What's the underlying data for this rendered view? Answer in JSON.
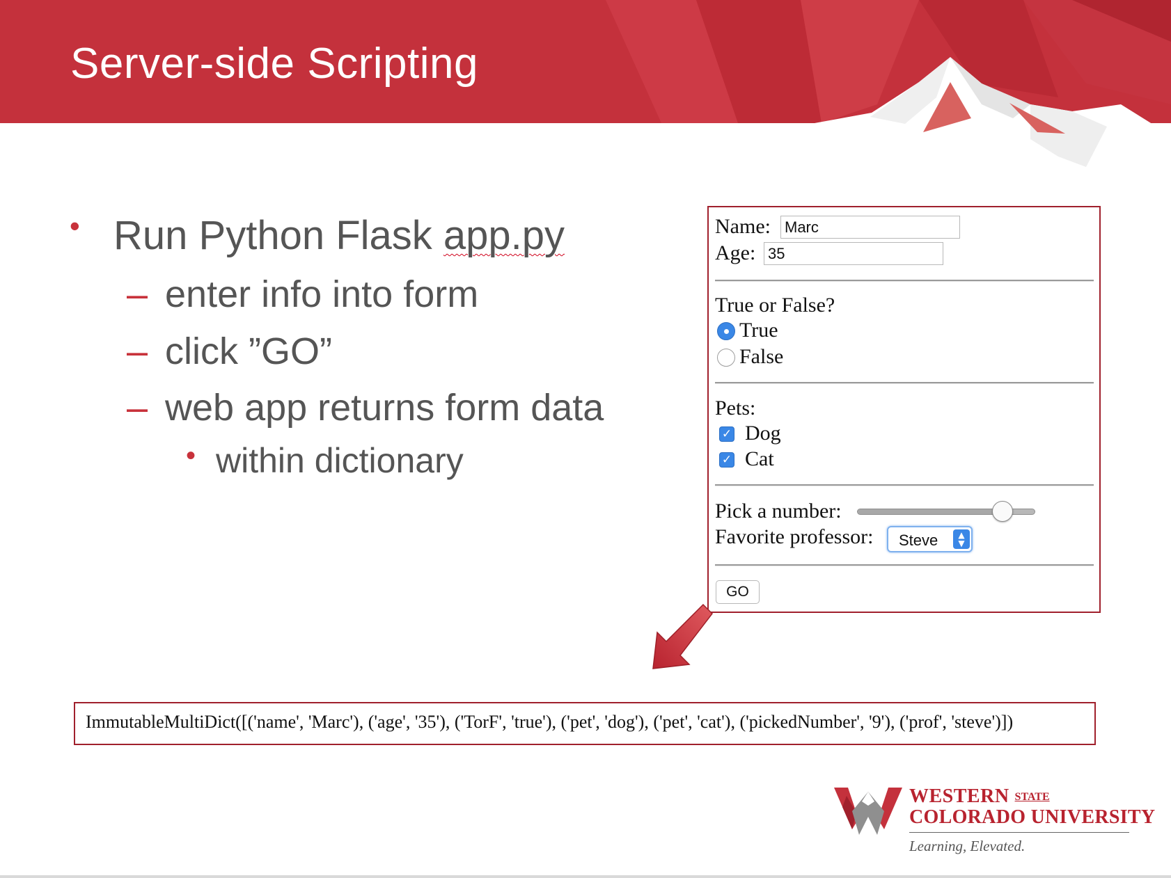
{
  "slide": {
    "title": "Server-side Scripting"
  },
  "bullets": {
    "l1_text_plain": "Run Python Flask ",
    "l1_text_underlined": "app.py",
    "l2_items": [
      "enter info into form",
      "click ”GO”",
      "web app returns form data"
    ],
    "l3_item": "within dictionary",
    "marker_dot": "•",
    "marker_dash": "–"
  },
  "form": {
    "name_label": "Name:",
    "name_value": "Marc",
    "age_label": "Age:",
    "age_value": "35",
    "torf_question": "True or False?",
    "torf_options": [
      {
        "label": "True",
        "selected": true
      },
      {
        "label": "False",
        "selected": false
      }
    ],
    "pets_label": "Pets:",
    "pets": [
      {
        "label": "Dog",
        "checked": true
      },
      {
        "label": "Cat",
        "checked": true
      }
    ],
    "pick_label": "Pick a number:",
    "slider_fraction": 0.86,
    "prof_label": "Favorite professor:",
    "prof_value": "Steve",
    "go_label": "GO"
  },
  "output": {
    "text": "ImmutableMultiDict([('name', 'Marc'), ('age', '35'), ('TorF', 'true'), ('pet', 'dog'), ('pet', 'cat'), ('pickedNumber', '9'), ('prof', 'steve')])"
  },
  "logo": {
    "line1_main": "WESTERN",
    "line1_small": "STATE",
    "line2": "COLORADO UNIVERSITY",
    "tagline": "Learning, Elevated."
  },
  "colors": {
    "brand_red": "#c8323b",
    "header_red": "#c4313c",
    "accent_blue": "#3a87e6"
  },
  "icons": [
    "arrow-down-left-icon",
    "checkmark-icon",
    "select-arrows-icon",
    "mountain-graphic",
    "university-w-logo"
  ]
}
